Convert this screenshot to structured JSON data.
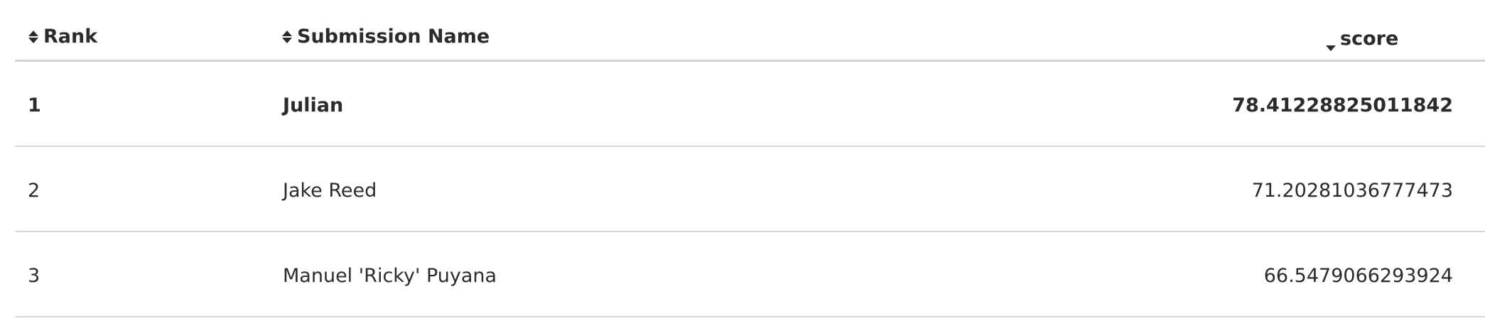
{
  "leaderboard": {
    "columns": {
      "rank": "Rank",
      "name": "Submission Name",
      "score": "score"
    },
    "rows": [
      {
        "rank": "1",
        "name": "Julian",
        "score": "78.41228825011842"
      },
      {
        "rank": "2",
        "name": "Jake Reed",
        "score": "71.20281036777473"
      },
      {
        "rank": "3",
        "name": "Manuel 'Ricky' Puyana",
        "score": "66.5479066293924"
      }
    ]
  },
  "icons": {
    "rank_sort": "sort-both-icon",
    "name_sort": "sort-both-icon",
    "score_sort": "sort-descending-icon"
  }
}
